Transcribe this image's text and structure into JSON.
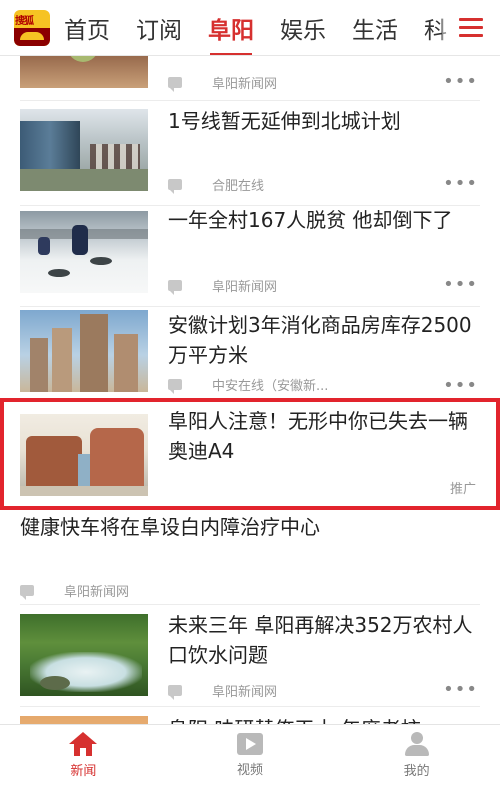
{
  "app": {
    "logo_text": "搜狐"
  },
  "tabs": [
    {
      "label": "首页",
      "active": false
    },
    {
      "label": "订阅",
      "active": false
    },
    {
      "label": "阜阳",
      "active": true
    },
    {
      "label": "娱乐",
      "active": false
    },
    {
      "label": "生活",
      "active": false
    },
    {
      "label": "科",
      "active": false
    }
  ],
  "accent_color": "#d6302f",
  "highlight_color": "#e2242d",
  "feed": {
    "item0": {
      "source": "阜阳新闻网",
      "more": "•••",
      "thumb_icon": "food-image"
    },
    "item1": {
      "headline": "1号线暂无延伸到北城计划",
      "source": "合肥在线",
      "more": "•••",
      "thumb_icon": "metro-station-image"
    },
    "item2": {
      "headline": "一年全村167人脱贫 他却倒下了",
      "source": "阜阳新闻网",
      "more": "•••",
      "thumb_icon": "ice-fishing-image"
    },
    "item3": {
      "headline": "安徽计划3年消化商品房库存2500万平方米",
      "source": "中安在线（安徽新...",
      "more": "•••",
      "thumb_icon": "city-buildings-image"
    },
    "ad": {
      "headline": "阜阳人注意！无形中你已失去一辆奥迪A4",
      "tag": "推广",
      "thumb_icon": "shopping-mall-image"
    },
    "item5": {
      "headline": "健康快车将在阜设白内障治疗中心",
      "source": "阜阳新闻网"
    },
    "item6": {
      "headline": "未来三年 阜阳再解决352万农村人口饮水问题",
      "source": "阜阳新闻网",
      "more": "•••",
      "thumb_icon": "stream-image"
    },
    "item7": {
      "headline": "阜阳·味研替俺干士 年度老柿"
    }
  },
  "bottom_nav": [
    {
      "label": "新闻",
      "icon": "home-icon",
      "active": true
    },
    {
      "label": "视频",
      "icon": "video-icon",
      "active": false
    },
    {
      "label": "我的",
      "icon": "user-icon",
      "active": false
    }
  ]
}
